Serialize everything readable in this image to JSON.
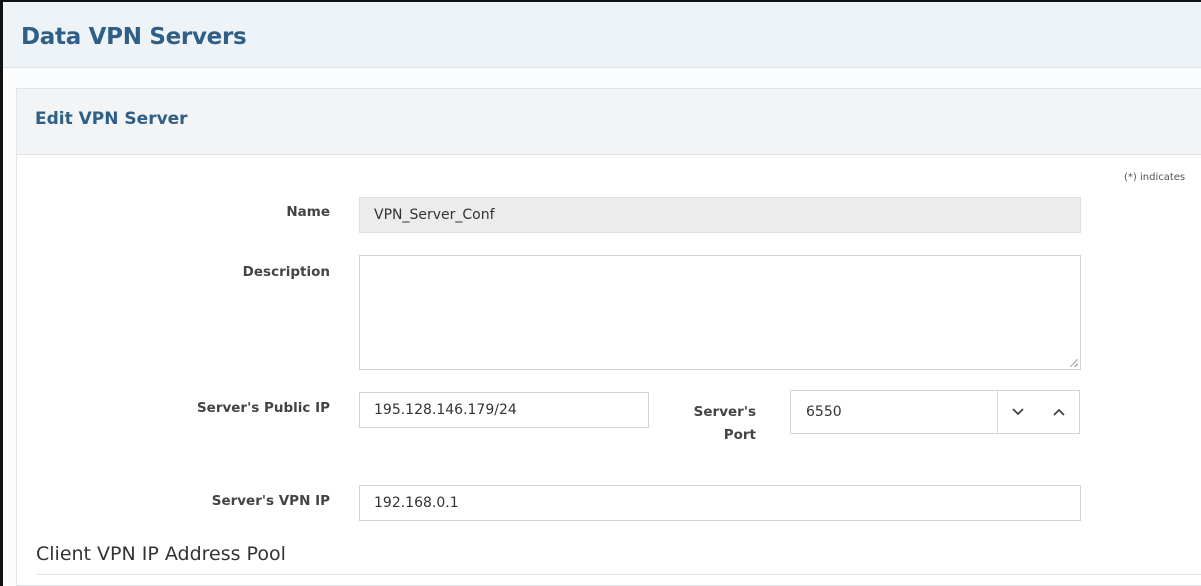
{
  "page": {
    "title": "Data VPN Servers"
  },
  "panel": {
    "title": "Edit VPN Server",
    "required_note": "(*) indicates"
  },
  "form": {
    "name": {
      "label": "Name",
      "value": "VPN_Server_Conf"
    },
    "description": {
      "label": "Description",
      "value": ""
    },
    "public_ip": {
      "label": "Server's Public IP",
      "value": "195.128.146.179/24"
    },
    "port": {
      "label_line1": "Server's",
      "label_line2": "Port",
      "value": "6550",
      "down_icon": "chevron-down",
      "up_icon": "chevron-up"
    },
    "vpn_ip": {
      "label": "Server's VPN IP",
      "value": "192.168.0.1"
    }
  },
  "section": {
    "title": "Client VPN IP Address Pool"
  },
  "colors": {
    "title_blue": "#2f5f86",
    "header_bg": "#eef3f8",
    "panel_header_bg": "#f3f4f5",
    "readonly_bg": "#ececec"
  }
}
